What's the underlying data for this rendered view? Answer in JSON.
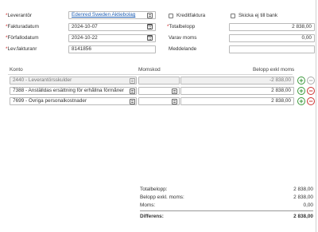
{
  "form": {
    "leverantor": {
      "label": "Leverantör",
      "value": "Edenred Sweden Aktiebolag"
    },
    "fakturadatum": {
      "label": "Fakturadatum",
      "value": "2024-10-07"
    },
    "forfallodatum": {
      "label": "Förfallodatum",
      "value": "2024-10-22"
    },
    "levfakturanr": {
      "label": "Lev.fakturanr",
      "value": "8141856"
    },
    "kreditfaktura": {
      "label": "Kreditfaktura",
      "checked": false
    },
    "skicka": {
      "label": "Skicka ej till bank",
      "checked": false
    },
    "totalbelopp": {
      "label": "Totalbelopp",
      "value": "2 838,00"
    },
    "varav_moms": {
      "label": "Varav moms",
      "value": "0,00"
    },
    "meddelande": {
      "label": "Meddelande",
      "value": ""
    },
    "required_marker": "*"
  },
  "table": {
    "columns": {
      "konto": "Konto",
      "momskod": "Momskod",
      "belopp": "Belopp exkl moms"
    },
    "rows": [
      {
        "konto": "2440 - Leverantörsskulder",
        "momskod": "",
        "belopp": "-2 838,00",
        "readonly": true
      },
      {
        "konto": "7388 - Anställdas ersättning för erhållna förmåner",
        "momskod": "",
        "belopp": "2 838,00",
        "readonly": false
      },
      {
        "konto": "7699 - Övriga personalkostnader",
        "momskod": "",
        "belopp": "2 838,00",
        "readonly": false
      }
    ],
    "add_symbol": "+",
    "remove_symbol": "−"
  },
  "summary": {
    "totalbelopp": {
      "label": "Totalbelopp:",
      "value": "2 838,00"
    },
    "belopp_exkl": {
      "label": "Belopp exkl. moms:",
      "value": "2 838,00"
    },
    "moms": {
      "label": "Moms:",
      "value": "0,00"
    },
    "differens": {
      "label": "Differens:",
      "value": "2 838,00"
    }
  },
  "colors": {
    "plus": "#3d9a3d",
    "minus": "#cc3333",
    "link": "#1f5fb4"
  }
}
